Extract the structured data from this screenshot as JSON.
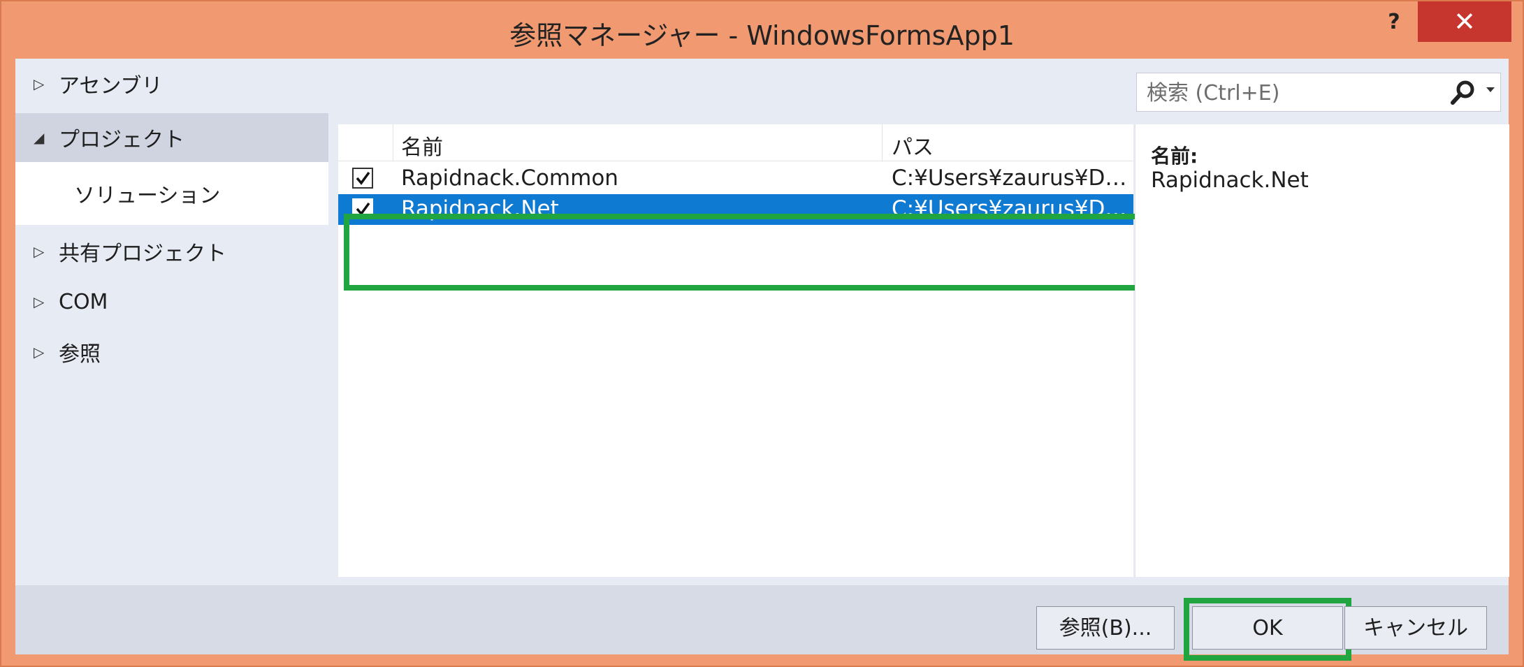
{
  "window": {
    "title": "参照マネージャー - WindowsFormsApp1",
    "help_label": "?",
    "close_label": "✕"
  },
  "nav": {
    "items": [
      {
        "label": "アセンブリ",
        "expanded": false
      },
      {
        "label": "プロジェクト",
        "expanded": true
      },
      {
        "label": "ソリューション"
      },
      {
        "label": "共有プロジェクト",
        "expanded": false
      },
      {
        "label": "COM",
        "expanded": false
      },
      {
        "label": "参照",
        "expanded": false
      }
    ],
    "collapsed_arrow": "▷",
    "expanded_arrow": "◢"
  },
  "search": {
    "placeholder": "検索 (Ctrl+E)",
    "icon": "search-icon"
  },
  "list": {
    "columns": [
      "名前",
      "パス"
    ],
    "rows": [
      {
        "checked": true,
        "name": "Rapidnack.Common",
        "path": "C:¥Users¥zaurus¥D…",
        "selected": false
      },
      {
        "checked": true,
        "name": "Rapidnack.Net",
        "path": "C:¥Users¥zaurus¥D…",
        "selected": true
      }
    ]
  },
  "details": {
    "label": "名前:",
    "value": "Rapidnack.Net"
  },
  "footer": {
    "browse_label": "参照(B)...",
    "ok_label": "OK",
    "cancel_label": "キャンセル"
  },
  "colors": {
    "window_frame": "#f19a71",
    "close_button": "#c7362e",
    "selection": "#0f7ad1",
    "highlight_box": "#20a540",
    "nav_selected": "#cfd4e0"
  }
}
